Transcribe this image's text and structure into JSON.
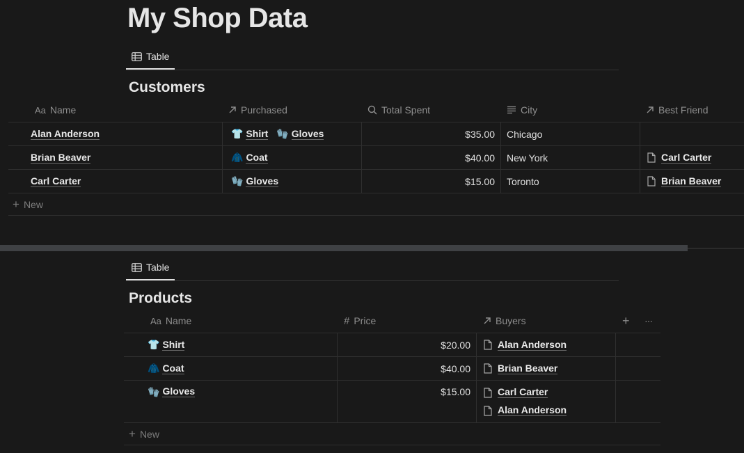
{
  "page": {
    "title": "My Shop Data"
  },
  "customers": {
    "tab_label": "Table",
    "title": "Customers",
    "columns": [
      {
        "label": "Name",
        "icon": "text-aa-icon"
      },
      {
        "label": "Purchased",
        "icon": "relation-arrow-icon"
      },
      {
        "label": "Total Spent",
        "icon": "search-icon"
      },
      {
        "label": "City",
        "icon": "lines-icon"
      },
      {
        "label": "Best Friend",
        "icon": "relation-arrow-icon"
      }
    ],
    "rows": [
      {
        "name": "Alan Anderson",
        "purchased": [
          {
            "emoji": "👕",
            "label": "Shirt"
          },
          {
            "emoji": "🧤",
            "label": "Gloves"
          }
        ],
        "total": "$35.00",
        "city": "Chicago",
        "best_friend": ""
      },
      {
        "name": "Brian Beaver",
        "purchased": [
          {
            "emoji": "🧥",
            "label": "Coat"
          }
        ],
        "total": "$40.00",
        "city": "New York",
        "best_friend": "Carl Carter"
      },
      {
        "name": "Carl Carter",
        "purchased": [
          {
            "emoji": "🧤",
            "label": "Gloves"
          }
        ],
        "total": "$15.00",
        "city": "Toronto",
        "best_friend": "Brian Beaver"
      }
    ],
    "new_label": "New"
  },
  "products": {
    "tab_label": "Table",
    "title": "Products",
    "columns": [
      {
        "label": "Name",
        "icon": "text-aa-icon"
      },
      {
        "label": "Price",
        "icon": "hash-icon"
      },
      {
        "label": "Buyers",
        "icon": "relation-arrow-icon"
      }
    ],
    "add_column": "+",
    "more": "···",
    "rows": [
      {
        "emoji": "👕",
        "name": "Shirt",
        "price": "$20.00",
        "buyers": [
          "Alan Anderson"
        ]
      },
      {
        "emoji": "🧥",
        "name": "Coat",
        "price": "$40.00",
        "buyers": [
          "Brian Beaver"
        ]
      },
      {
        "emoji": "🧤",
        "name": "Gloves",
        "price": "$15.00",
        "buyers": [
          "Carl Carter",
          "Alan Anderson"
        ]
      }
    ],
    "new_label": "New"
  },
  "aa": "Aa"
}
